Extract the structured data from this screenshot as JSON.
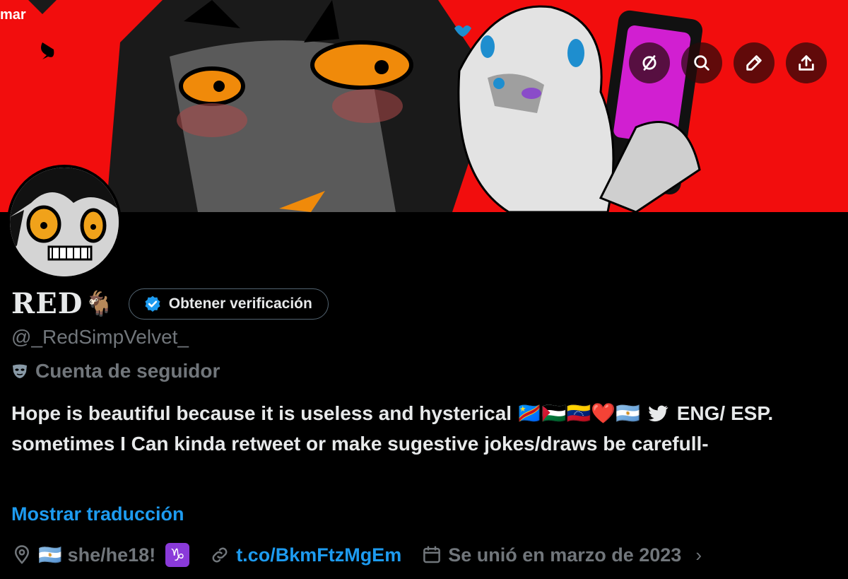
{
  "banner": {
    "top_left_text": "mar",
    "art_description_icon": "anime-banner-art"
  },
  "actions": [
    {
      "name": "grok-icon-button",
      "icon": "slashed-circle-icon"
    },
    {
      "name": "search-button",
      "icon": "search-icon"
    },
    {
      "name": "edit-button",
      "icon": "pencil-icon"
    },
    {
      "name": "share-button",
      "icon": "share-upload-icon"
    }
  ],
  "profile": {
    "display_name": "RED",
    "name_emoji": "🐐",
    "verify_label": "Obtener verificación",
    "handle": "@_RedSimpVelvet_",
    "account_type": "Cuenta de seguidor",
    "bio_line1": "Hope is beautiful because it is useless and hysterical",
    "bio_emojis": "🇨🇩🇵🇸🇻🇪❤️🇦🇷",
    "bio_line1_end": "ENG/",
    "bio_rest": "ESP. sometimes I Can kinda retweet or make sugestive jokes/draws be carefull-",
    "translate_label": "Mostrar traducción"
  },
  "meta": {
    "location_flag": "🇦🇷",
    "location_text": "she/he18!",
    "zodiac": "♑",
    "link_text": "t.co/BkmFtzMgEm",
    "joined_text": "Se unió en marzo de 2023",
    "chevron": "›"
  },
  "colors": {
    "banner_red": "#f20d0d",
    "link_blue": "#1d9bf0",
    "muted_gray": "#71767b",
    "text": "#e7e9ea",
    "zodiac_purple": "#8a3ad9"
  }
}
